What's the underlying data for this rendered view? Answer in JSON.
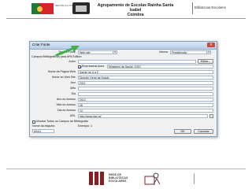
{
  "header": {
    "gov_text": "REPÚBLICA PORTUGUESA",
    "school_title_line1": "Agrupamento de Escolas Rainha Santa Isabel",
    "school_title_line2": "Coimbra",
    "section": "Bibliotecas Escolares"
  },
  "dialog": {
    "title": "Criar Fonte",
    "close_glyph": "✕",
    "source_type_label": "Tipo de Fonte",
    "source_type_value": "Web site",
    "language_label": "Idioma",
    "language_value": "Predefinição",
    "fields_caption": "Campos Bibliográficos para APA Edition",
    "author_label": "Autor",
    "edit_button": "Editar...",
    "corporate_author_checkbox": "Empresarial Autor",
    "corporate_author_value": "Ministério da Saúde -DGS",
    "page_name_label": "Nome da Página Web",
    "page_name_value": "Saúde de A a Z",
    "site_name_label": "Nome do Web Site",
    "site_name_value": "Direção Geral da Saúde",
    "year_label": "Ano",
    "year_value": "2011",
    "month_label": "Mês",
    "month_value": "",
    "day_label": "Dia",
    "day_value": "",
    "access_year_label": "Ano do Acesso",
    "access_year_value": "2012",
    "access_month_label": "Mês do Acesso",
    "access_month_value": "06",
    "access_day_label": "Dia do Acesso",
    "access_day_value": "10",
    "url_label": "URL",
    "url_value": "http://www.dgs.pt/",
    "show_all_checkbox": "Mostrar Todos os Campos de Bibliografia",
    "tag_name_label": "Nome da etiqueta",
    "tag_name_value": "Min11",
    "example_label": "Exemplo: 1",
    "ok_button": "OK",
    "cancel_button": "Cancelar"
  },
  "footer": {
    "rbe_line1": "REDE DE",
    "rbe_line2": "BIBLIOTECAS",
    "rbe_line3": "ESCOLARES"
  },
  "colors": {
    "accent_arrow": "#3fb04a",
    "rbe_brand": "#8a1c22"
  }
}
